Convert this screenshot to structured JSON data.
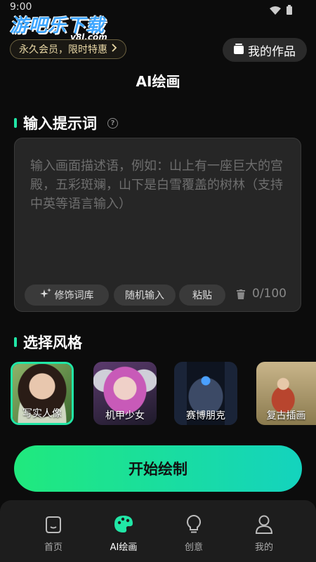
{
  "status_bar": {
    "time": "9:00"
  },
  "watermark": {
    "main": "游吧乐下载",
    "sub": "y8l.com"
  },
  "header": {
    "vip_label": "永久会员，限时特惠",
    "works_label": "我的作品",
    "title": "AI绘画"
  },
  "prompt_section": {
    "title": "输入提示词",
    "placeholder": "输入画面描述语，例如：山上有一座巨大的宫殿，五彩斑斓，山下是白雪覆盖的树林（支持中英等语言输入）",
    "value": "",
    "chips": [
      "修饰词库",
      "随机输入",
      "粘贴"
    ],
    "counter": "0/100"
  },
  "style_section": {
    "title": "选择风格",
    "styles": [
      {
        "label": "写实人像",
        "selected": true
      },
      {
        "label": "机甲少女",
        "selected": false
      },
      {
        "label": "赛博朋克",
        "selected": false
      },
      {
        "label": "复古插画",
        "selected": false
      }
    ]
  },
  "start_button": {
    "label": "开始绘制"
  },
  "bottom_nav": {
    "items": [
      {
        "label": "首页",
        "icon": "home-icon",
        "active": false
      },
      {
        "label": "AI绘画",
        "icon": "palette-icon",
        "active": true
      },
      {
        "label": "创意",
        "icon": "bulb-icon",
        "active": false
      },
      {
        "label": "我的",
        "icon": "user-icon",
        "active": false
      }
    ]
  },
  "colors": {
    "accent": "#21e6a6",
    "gradient_start": "#20e97d",
    "gradient_end": "#14d3be",
    "vip_text": "#e9d8a6"
  }
}
